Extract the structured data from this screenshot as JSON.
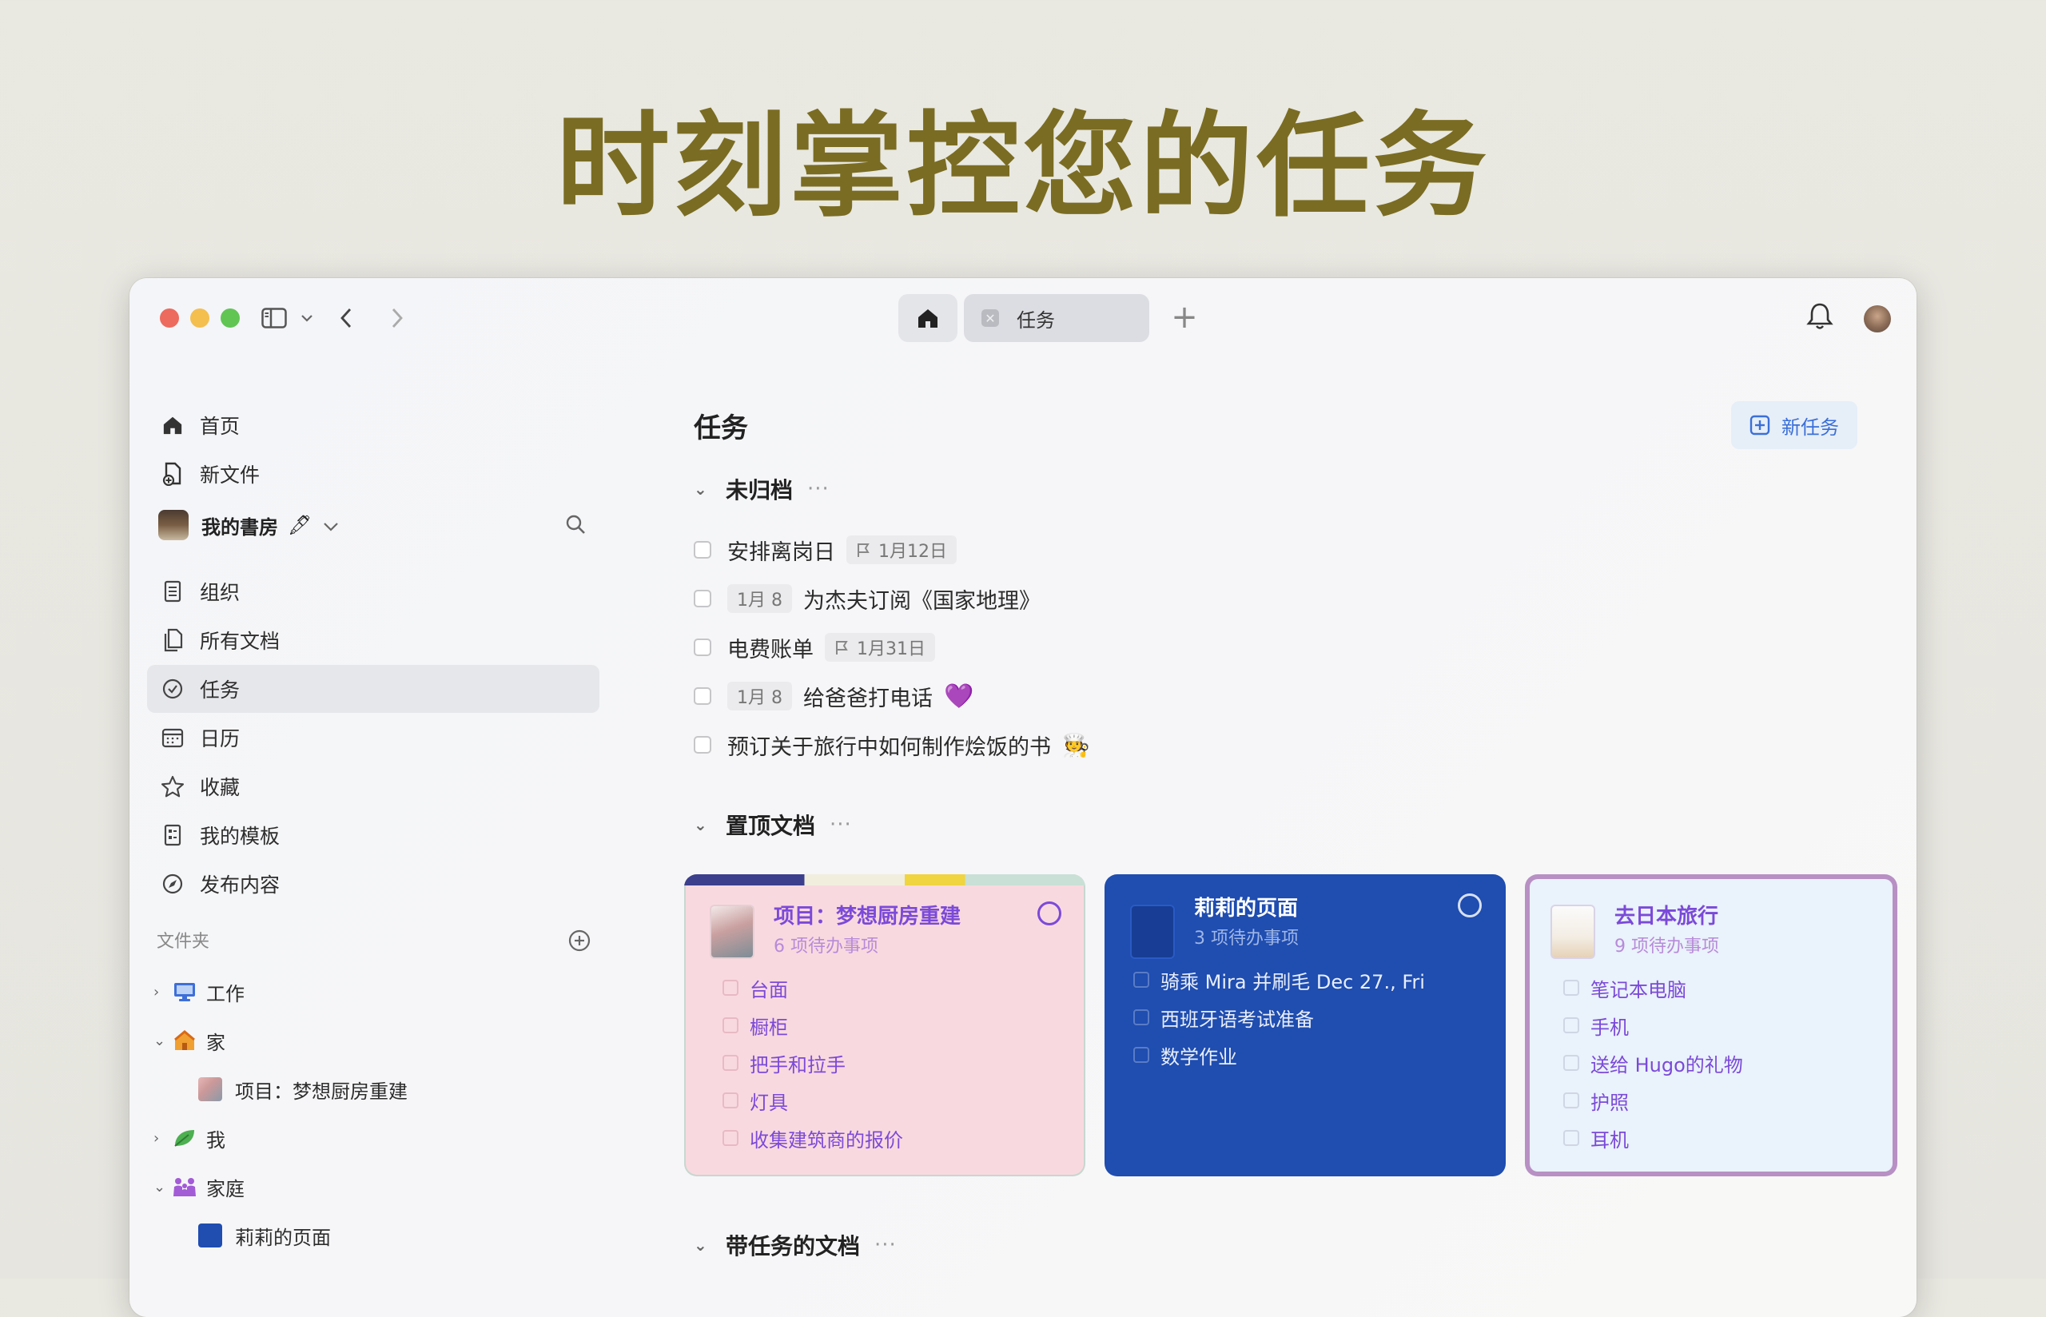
{
  "headline": "时刻掌控您的任务",
  "titlebar": {
    "tab_task_label": "任务",
    "tab_add": "+"
  },
  "sidebar": {
    "nav": [
      {
        "label": "首页",
        "icon": "home-icon"
      },
      {
        "label": "新文件",
        "icon": "new-file-icon"
      }
    ],
    "library": {
      "name": "我的書房",
      "emoji": "🖋"
    },
    "items": [
      {
        "label": "组织",
        "icon": "organize-icon"
      },
      {
        "label": "所有文档",
        "icon": "all-docs-icon"
      },
      {
        "label": "任务",
        "icon": "task-check-icon",
        "active": true
      },
      {
        "label": "日历",
        "icon": "calendar-icon"
      },
      {
        "label": "收藏",
        "icon": "star-icon"
      },
      {
        "label": "我的模板",
        "icon": "template-icon"
      },
      {
        "label": "发布内容",
        "icon": "publish-icon"
      }
    ],
    "folders_label": "文件夹",
    "tree": [
      {
        "label": "工作",
        "icon": "monitor-icon",
        "expanded": false
      },
      {
        "label": "家",
        "icon": "house-icon",
        "expanded": true
      },
      {
        "label": "项目：梦想厨房重建",
        "child": true
      },
      {
        "label": "我",
        "icon": "leaf-icon",
        "expanded": false
      },
      {
        "label": "家庭",
        "icon": "family-icon",
        "expanded": true
      },
      {
        "label": "莉莉的页面",
        "child": true
      }
    ]
  },
  "main": {
    "title": "任务",
    "new_task_label": "新任务",
    "sections": {
      "unfiled": "未归档",
      "pinned": "置顶文档",
      "with_tasks": "带任务的文档",
      "dots": "···"
    },
    "tasks": [
      {
        "text": "安排离岗日",
        "flag_date": "1月12日"
      },
      {
        "pre_date": "1月 8",
        "text": "为杰夫订阅《国家地理》"
      },
      {
        "text": "电费账单",
        "flag_date": "1月31日"
      },
      {
        "pre_date": "1月 8",
        "text": "给爸爸打电话",
        "emoji": "💜"
      },
      {
        "text": "预订关于旅行中如何制作烩饭的书",
        "emoji": "🧑‍🍳"
      }
    ],
    "cards": [
      {
        "title": "项目：梦想厨房重建",
        "sub": "6 项待办事项",
        "items": [
          "台面",
          "橱柜",
          "把手和拉手",
          "灯具",
          "收集建筑商的报价"
        ],
        "accent": "#7b4ad8"
      },
      {
        "title": "莉莉的页面",
        "sub": "3 项待办事项",
        "items": [
          "骑乘 Mira 并刷毛 Dec 27., Fri",
          "西班牙语考试准备",
          "数学作业"
        ],
        "accent": "#ffffff"
      },
      {
        "title": "去日本旅行",
        "sub": "9 项待办事项",
        "items": [
          "笔记本电脑",
          "手机",
          "送给 Hugo的礼物",
          "护照",
          "耳机"
        ],
        "accent": "#7b4ad8"
      }
    ]
  }
}
